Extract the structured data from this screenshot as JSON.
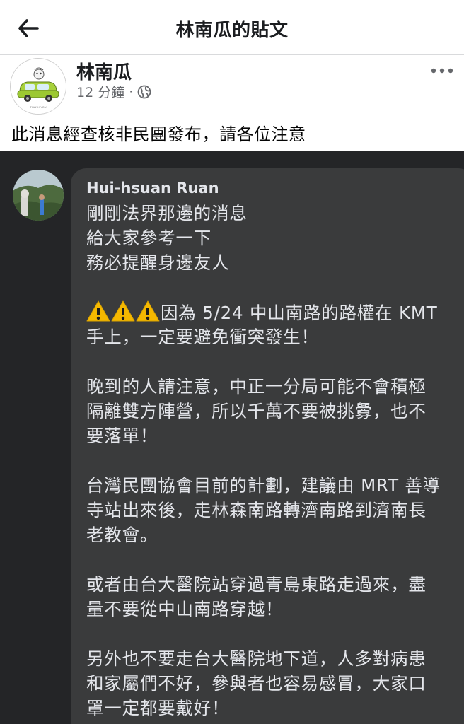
{
  "header": {
    "title": "林南瓜的貼文",
    "back_icon": "back-arrow-icon"
  },
  "post": {
    "author": "林南瓜",
    "time": "12 分鐘",
    "separator": "·",
    "privacy_icon": "globe-icon",
    "more_icon": "more-dots-icon",
    "text": "此消息經查核非民團發布，請各位注意",
    "avatar_caption": "THANK YOU"
  },
  "screenshot": {
    "background": "#242527",
    "bubble_color": "#3a3b3c",
    "commenter": "Hui-hsuan Ruan",
    "warning_icon": "warning-icon",
    "lines": {
      "l1": "剛剛法界那邊的消息",
      "l2": "給大家參考一下",
      "l3": "務必提醒身邊友人",
      "l4": "因為 5/24 中山南路的路權在 KMT",
      "l5": "手上，一定要避免衝突發生！",
      "l6": "晚到的人請注意，中正一分局可能不會積極",
      "l7": "隔離雙方陣營，所以千萬不要被挑釁，也不",
      "l8": "要落單！",
      "l9": "台灣民團協會目前的計劃，建議由 MRT 善導",
      "l10": "寺站出來後，走林森南路轉濟南路到濟南長",
      "l11": "老教會。",
      "l12": "或者由台大醫院站穿過青島東路走過來，盡",
      "l13": "量不要從中山南路穿越！",
      "l14": "另外也不要走台大醫院地下道，人多對病患",
      "l15": "和家屬們不好，參與者也容易感冒，大家口",
      "l16": "罩一定都要戴好！"
    }
  }
}
